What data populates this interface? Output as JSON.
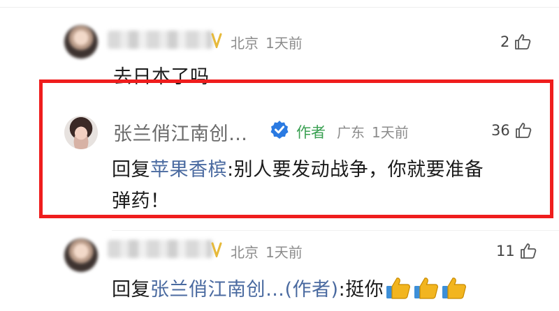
{
  "colors": {
    "highlight_border": "#ef1d1d",
    "reply_link": "#4a6aa0",
    "author_tag": "#3aa052",
    "verified_badge": "#2a7ae2",
    "vip_badge": "#e6b93a",
    "emoji_thumb": "#f2b51f"
  },
  "comments": [
    {
      "location": "北京",
      "time": "1天前",
      "likes": "2",
      "text": "去日本了吗"
    },
    {
      "name": "张兰俏江南创…",
      "author_tag": "作者",
      "location": "广东",
      "time": "1天前",
      "likes": "36",
      "reply_prefix": "回复",
      "reply_target": "苹果香槟",
      "reply_sep": ":",
      "text_line1": "别人要发动战争，你就要准备",
      "text_line2": "弹药！"
    },
    {
      "location": "北京",
      "time": "1天前",
      "likes": "11",
      "reply_prefix": "回复",
      "reply_target": "张兰俏江南创…(作者)",
      "reply_sep": ":",
      "text": "挺你",
      "emoji_name": "thumbs-up-emoji",
      "emoji_count": 3
    }
  ]
}
